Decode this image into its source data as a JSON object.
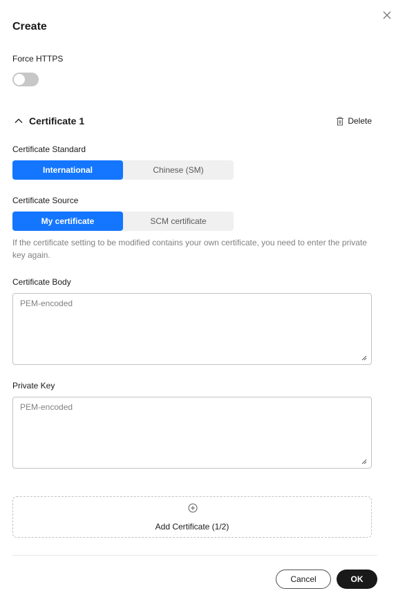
{
  "dialog": {
    "title": "Create"
  },
  "force_https": {
    "label": "Force HTTPS",
    "enabled": false
  },
  "certificate": {
    "title": "Certificate 1",
    "delete_label": "Delete",
    "standard": {
      "label": "Certificate Standard",
      "options": [
        "International",
        "Chinese (SM)"
      ],
      "selected": "International"
    },
    "source": {
      "label": "Certificate Source",
      "options": [
        "My certificate",
        "SCM certificate"
      ],
      "selected": "My certificate",
      "hint": "If the certificate setting to be modified contains your own certificate, you need to enter the private key again."
    },
    "body": {
      "label": "Certificate Body",
      "placeholder": "PEM-encoded",
      "value": ""
    },
    "private_key": {
      "label": "Private Key",
      "placeholder": "PEM-encoded",
      "value": ""
    }
  },
  "add_certificate": {
    "label": "Add Certificate  (1/2)"
  },
  "footer": {
    "cancel_label": "Cancel",
    "ok_label": "OK"
  },
  "icons": {
    "close": "close-icon",
    "chevron": "chevron-up-icon",
    "delete": "trash-icon",
    "add": "plus-circle-icon"
  },
  "colors": {
    "primary": "#1476ff",
    "ok_button": "#191919",
    "toggle_off": "#c7c7c7"
  }
}
